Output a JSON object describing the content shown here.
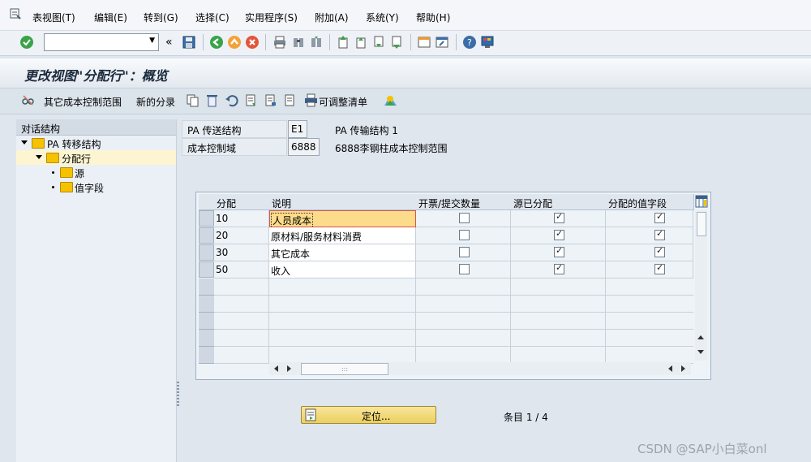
{
  "menu": {
    "items": [
      "表视图(T)",
      "编辑(E)",
      "转到(G)",
      "选择(C)",
      "实用程序(S)",
      "附加(A)",
      "系统(Y)",
      "帮助(H)"
    ]
  },
  "toolbar": {
    "command_value": "",
    "collapse_glyph": "«",
    "dropdown_glyph": "▼"
  },
  "title": "更改视图\"分配行\"：概览",
  "app_toolbar": {
    "btn_other_scope": "其它成本控制范围",
    "btn_new_entries": "新的分录",
    "btn_adjustable_list": "可调整清单"
  },
  "tree": {
    "header": "对话结构",
    "items": [
      {
        "label": "PA 转移结构",
        "level": 0,
        "expanded": true
      },
      {
        "label": "分配行",
        "level": 1,
        "expanded": true,
        "selected": true
      },
      {
        "label": "源",
        "level": 2
      },
      {
        "label": "值字段",
        "level": 2
      }
    ]
  },
  "fields": {
    "pa_structure_label": "PA 传送结构",
    "pa_structure_value": "E1",
    "pa_structure_desc": "PA 传输结构 1",
    "co_area_label": "成本控制域",
    "co_area_value": "6888",
    "co_area_desc": "6888李钢柱成本控制范围"
  },
  "table": {
    "headers": [
      "分配",
      "说明",
      "开票/提交数量",
      "源已分配",
      "分配的值字段"
    ],
    "rows": [
      {
        "assignment": "10",
        "description": "人员成本",
        "billing": false,
        "source": true,
        "value": true
      },
      {
        "assignment": "20",
        "description": "原材料/服务材料消费",
        "billing": false,
        "source": true,
        "value": true
      },
      {
        "assignment": "30",
        "description": "其它成本",
        "billing": false,
        "source": true,
        "value": true
      },
      {
        "assignment": "50",
        "description": "收入",
        "billing": false,
        "source": true,
        "value": true
      }
    ],
    "empty_rows": 5,
    "hscroll_grip": ":::"
  },
  "position_button": "定位...",
  "entry_count": "条目 1 / 4",
  "watermark": "CSDN @SAP小白菜onl",
  "colors": {
    "accent_green": "#3aa34a",
    "selection": "#fcdc8a",
    "gold_button": "#f3dc7f"
  }
}
